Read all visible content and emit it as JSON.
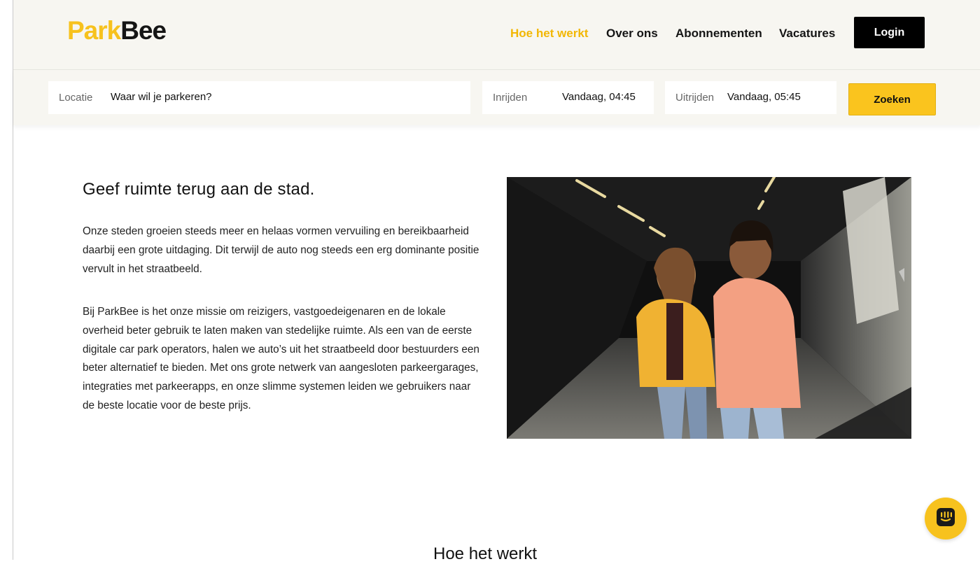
{
  "header": {
    "logo_part1": "Park",
    "logo_part2": "Bee",
    "nav": [
      {
        "label": "Hoe het werkt",
        "active": true
      },
      {
        "label": "Over ons",
        "active": false
      },
      {
        "label": "Abonnementen",
        "active": false
      },
      {
        "label": "Vacatures",
        "active": false
      }
    ],
    "login_label": "Login"
  },
  "search": {
    "location_label": "Locatie",
    "location_placeholder": "Waar wil je parkeren?",
    "entry_label": "Inrijden",
    "entry_value": "Vandaag, 04:45",
    "exit_label": "Uitrijden",
    "exit_value": "Vandaag, 05:45",
    "button_label": "Zoeken"
  },
  "content": {
    "heading": "Geef ruimte terug aan de stad.",
    "paragraph1": "Onze steden groeien steeds meer en helaas vormen vervuiling en bereikbaarheid daarbij een grote uitdaging. Dit terwijl de auto nog steeds een erg dominante positie vervult in het straatbeeld.",
    "paragraph2": "Bij ParkBee is het onze missie om reizigers, vastgoedeigenaren en de lokale overheid beter gebruik te laten maken van stedelijke ruimte. Als een van de eerste digitale car park operators, halen we auto’s uit het straatbeeld door bestuurders een beter alternatief te bieden. Met ons grote netwerk van aangesloten parkeergarages, integraties met parkeerapps, en onze slimme systemen leiden we gebruikers naar de beste locatie voor de beste prijs.",
    "next_heading": "Hoe het werkt"
  },
  "colors": {
    "brand_yellow": "#f7c21e",
    "active_nav": "#f2b705",
    "header_bg": "#f7f6f1"
  },
  "icons": {
    "chat": "chat-icon"
  }
}
